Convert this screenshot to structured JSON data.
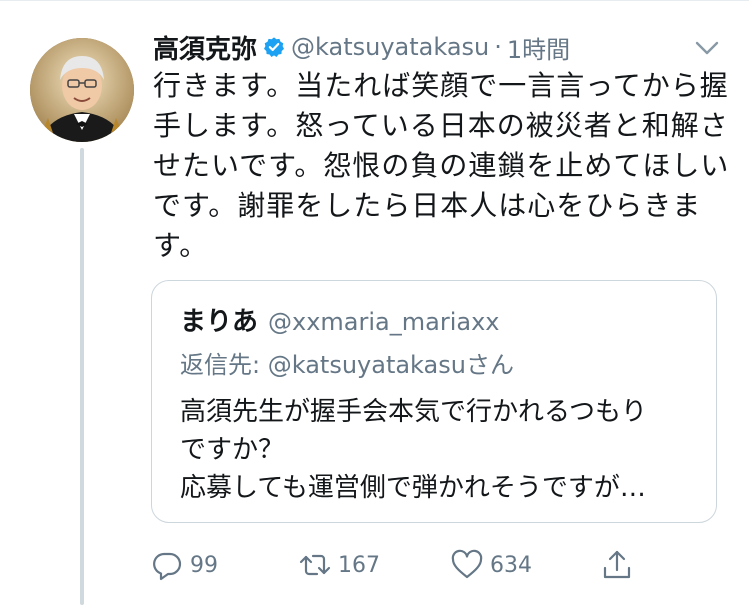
{
  "tweet": {
    "display_name": "高須克弥",
    "handle": "@katsuyatakasu",
    "separator": "·",
    "time": "1時間",
    "text_lines": [
      "行きます。当たれば笑顔で一言言ってから握",
      "手します。怒っている日本の被災者と和解さ",
      "せたいです。怨恨の負の連鎖を止めてほしい",
      "です。謝罪をしたら日本人は心をひらきま",
      "す。"
    ]
  },
  "quote": {
    "display_name": "まりあ",
    "handle": "@xxmaria_mariaxx",
    "reply_prefix": "返信先: ",
    "reply_mention": "@katsuyatakasu",
    "reply_suffix": "さん",
    "text_lines": [
      "高須先生が握手会本気で行かれるつもり",
      "ですか？",
      "応募しても運営側で弾かれそうですが…"
    ]
  },
  "actions": {
    "replies": "99",
    "retweets": "167",
    "likes": "634"
  },
  "colors": {
    "text": "#14171a",
    "secondary": "#657786",
    "verified": "#1da1f2",
    "border": "#ccd6dd",
    "thread_line": "#cfd9de"
  },
  "icons": [
    "verified-badge-icon",
    "chevron-down-icon",
    "reply-icon",
    "retweet-icon",
    "heart-icon",
    "share-icon"
  ]
}
